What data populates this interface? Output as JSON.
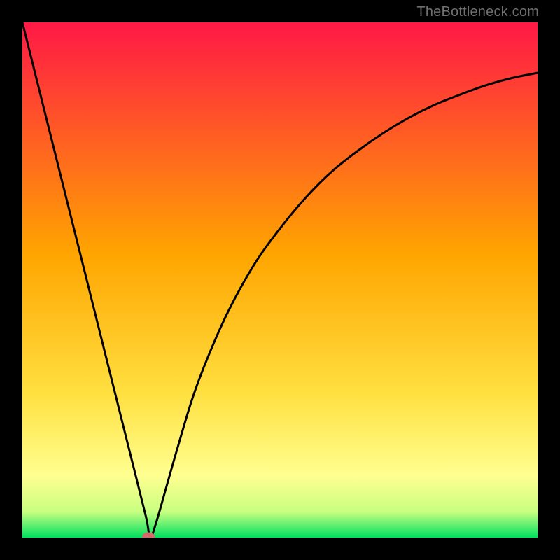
{
  "credit": "TheBottleneck.com",
  "chart_data": {
    "type": "line",
    "title": "",
    "xlabel": "",
    "ylabel": "",
    "xlim": [
      0,
      1
    ],
    "ylim": [
      0,
      1
    ],
    "gradient_top": "#ff1846",
    "gradient_mid": "#ffc300",
    "gradient_low": "#ffff80",
    "gradient_bottom": "#00e060",
    "marker": {
      "x": 0.245,
      "y": 0.002,
      "color": "#d46a6a",
      "r": 8
    },
    "series": [
      {
        "name": "curve",
        "points": [
          {
            "x": 0.0,
            "y": 1.0
          },
          {
            "x": 0.03,
            "y": 0.88
          },
          {
            "x": 0.06,
            "y": 0.76
          },
          {
            "x": 0.09,
            "y": 0.64
          },
          {
            "x": 0.12,
            "y": 0.52
          },
          {
            "x": 0.15,
            "y": 0.4
          },
          {
            "x": 0.18,
            "y": 0.28
          },
          {
            "x": 0.21,
            "y": 0.16
          },
          {
            "x": 0.24,
            "y": 0.04
          },
          {
            "x": 0.248,
            "y": 0.0
          },
          {
            "x": 0.26,
            "y": 0.03
          },
          {
            "x": 0.28,
            "y": 0.1
          },
          {
            "x": 0.3,
            "y": 0.17
          },
          {
            "x": 0.33,
            "y": 0.27
          },
          {
            "x": 0.36,
            "y": 0.35
          },
          {
            "x": 0.4,
            "y": 0.44
          },
          {
            "x": 0.45,
            "y": 0.53
          },
          {
            "x": 0.5,
            "y": 0.6
          },
          {
            "x": 0.55,
            "y": 0.66
          },
          {
            "x": 0.6,
            "y": 0.71
          },
          {
            "x": 0.65,
            "y": 0.75
          },
          {
            "x": 0.7,
            "y": 0.785
          },
          {
            "x": 0.75,
            "y": 0.815
          },
          {
            "x": 0.8,
            "y": 0.84
          },
          {
            "x": 0.85,
            "y": 0.86
          },
          {
            "x": 0.9,
            "y": 0.878
          },
          {
            "x": 0.95,
            "y": 0.892
          },
          {
            "x": 1.0,
            "y": 0.902
          }
        ]
      }
    ]
  }
}
